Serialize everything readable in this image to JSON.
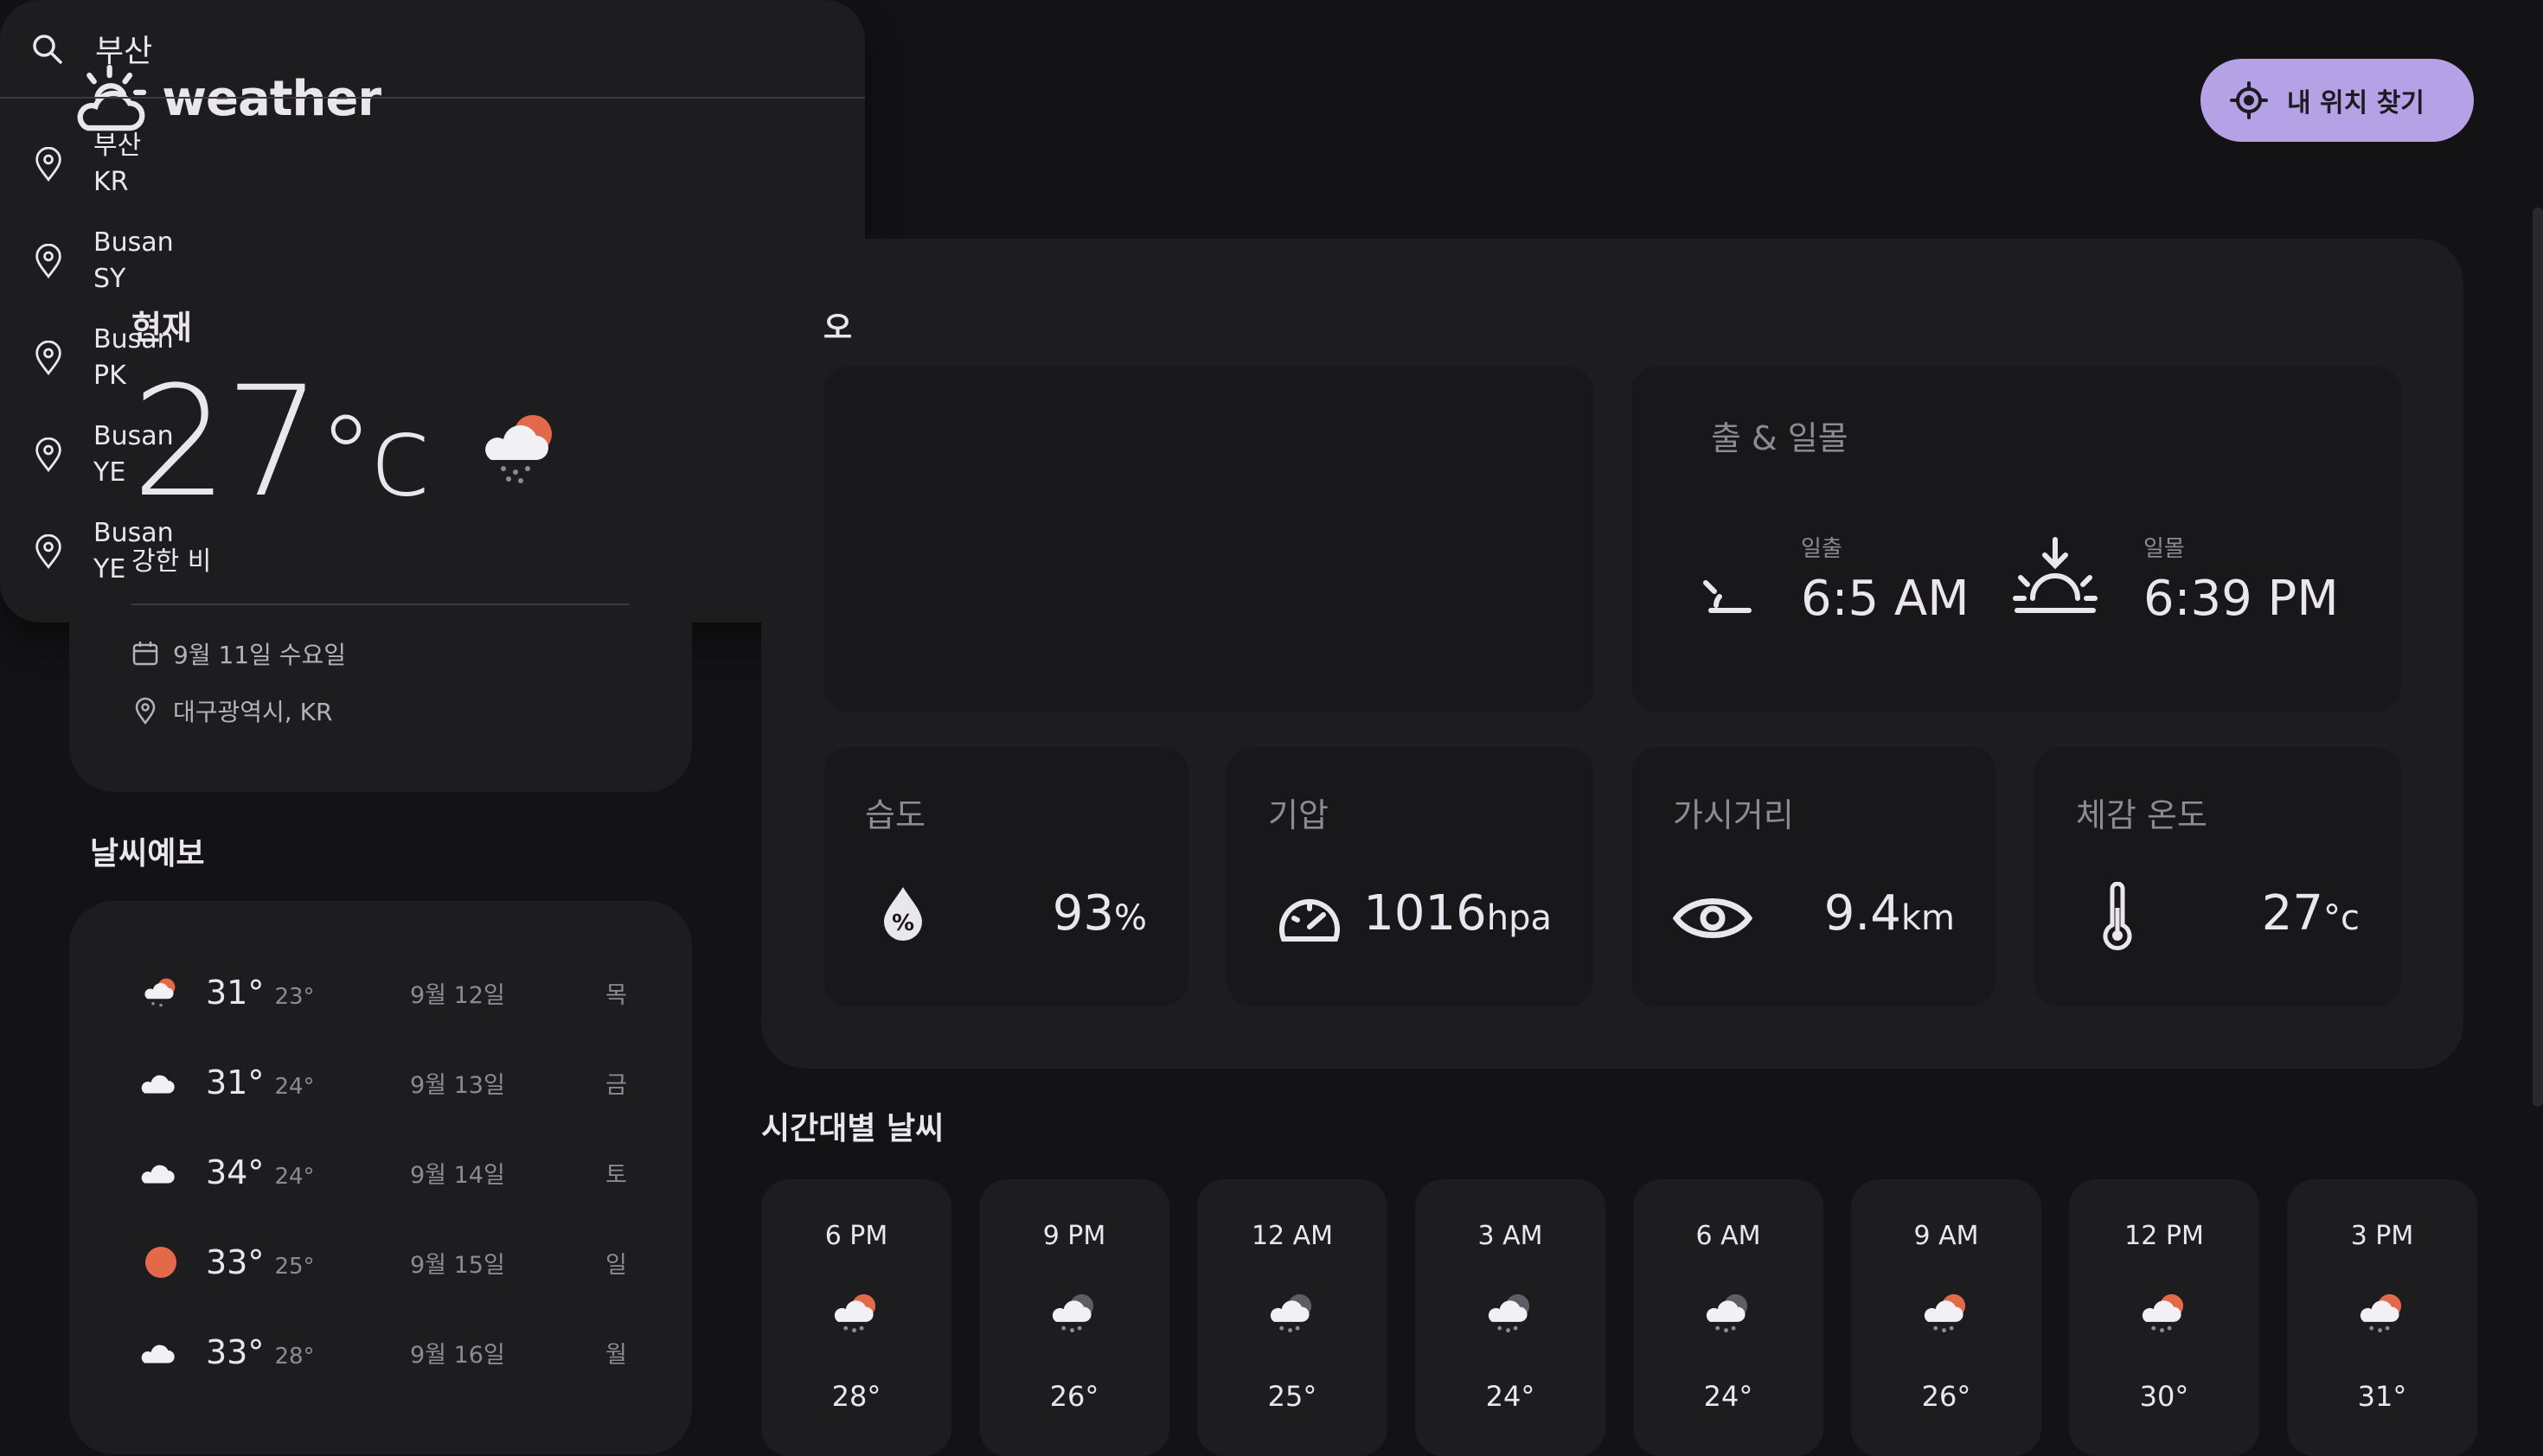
{
  "app": {
    "logo_text": "weather",
    "locate_button": "내 위치 찾기"
  },
  "search": {
    "query": "부산",
    "results": [
      {
        "name": "부산",
        "country": "KR"
      },
      {
        "name": "Busan",
        "country": "SY"
      },
      {
        "name": "Busan",
        "country": "PK"
      },
      {
        "name": "Busan",
        "country": "YE"
      },
      {
        "name": "Busan",
        "country": "YE"
      }
    ]
  },
  "current": {
    "title": "현재",
    "temp": "27",
    "unit": "°c",
    "description": "강한 비",
    "date": "9월 11일 수요일",
    "location": "대구광역시, KR",
    "icon": "rain-sun-icon"
  },
  "forecast": {
    "title": "날씨예보",
    "days": [
      {
        "high": "31°",
        "low": "23°",
        "date": "9월 12일",
        "weekday": "목",
        "icon": "rain-sun-icon"
      },
      {
        "high": "31°",
        "low": "24°",
        "date": "9월 13일",
        "weekday": "금",
        "icon": "cloud-icon"
      },
      {
        "high": "34°",
        "low": "24°",
        "date": "9월 14일",
        "weekday": "토",
        "icon": "cloud-icon"
      },
      {
        "high": "33°",
        "low": "25°",
        "date": "9월 15일",
        "weekday": "일",
        "icon": "sun-icon"
      },
      {
        "high": "33°",
        "low": "28°",
        "date": "9월 16일",
        "weekday": "월",
        "icon": "cloud-icon"
      }
    ]
  },
  "highlights": {
    "title_partial": "오",
    "sun_title_partial": "출 & 일몰",
    "sunrise_label": "일출",
    "sunrise_time": "6:5 AM",
    "sunset_label": "일몰",
    "sunset_time": "6:39 PM",
    "humidity": {
      "label": "습도",
      "value": "93",
      "unit": "%"
    },
    "pressure": {
      "label": "기압",
      "value": "1016",
      "unit": "hpa"
    },
    "visibility": {
      "label": "가시거리",
      "value": "9.4",
      "unit": "km"
    },
    "feels_like": {
      "label": "체감 온도",
      "value": "27",
      "unit": "°c"
    }
  },
  "hourly": {
    "title": "시간대별 날씨",
    "items": [
      {
        "time": "6 PM",
        "temp": "28°",
        "icon": "rain-sun-icon"
      },
      {
        "time": "9 PM",
        "temp": "26°",
        "icon": "rain-moon-icon"
      },
      {
        "time": "12 AM",
        "temp": "25°",
        "icon": "rain-moon-icon"
      },
      {
        "time": "3 AM",
        "temp": "24°",
        "icon": "rain-moon-icon"
      },
      {
        "time": "6 AM",
        "temp": "24°",
        "icon": "rain-moon-icon"
      },
      {
        "time": "9 AM",
        "temp": "26°",
        "icon": "rain-sun-icon"
      },
      {
        "time": "12 PM",
        "temp": "30°",
        "icon": "rain-sun-icon"
      },
      {
        "time": "3 PM",
        "temp": "31°",
        "icon": "rain-sun-icon"
      }
    ]
  },
  "colors": {
    "accent": "#b5a1e5",
    "background": "#131214",
    "card": "#1d1c1f",
    "sun": "#e2694a"
  }
}
